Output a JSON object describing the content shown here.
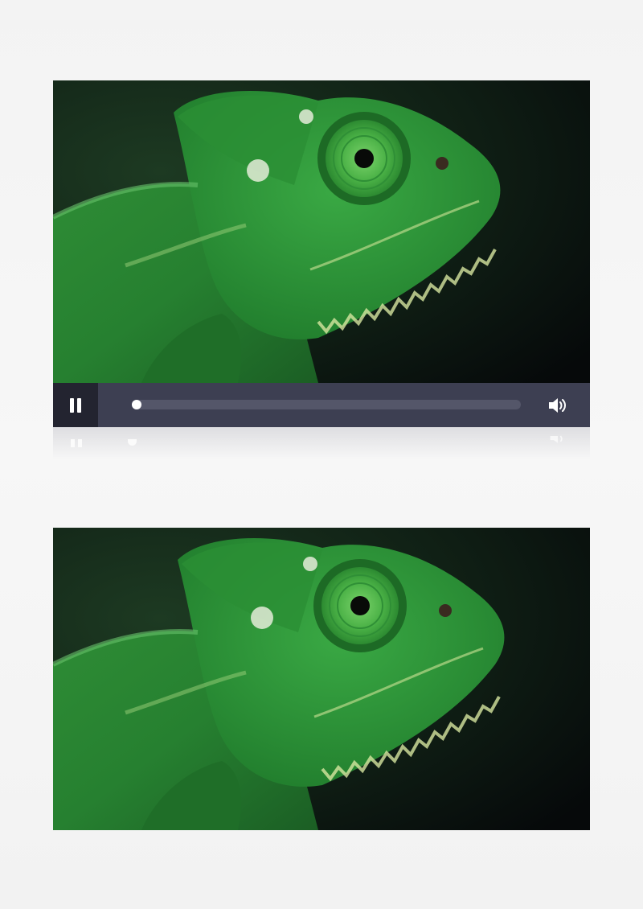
{
  "player": {
    "state": "playing",
    "progress_fraction": 0.0,
    "controls": {
      "play_pause_icon": "pause-icon",
      "volume_icon": "volume-icon"
    }
  },
  "colors": {
    "control_bar": "#3d3f52",
    "play_button_bg": "#232430",
    "track": "#545669",
    "thumb": "#ffffff",
    "chameleon_green": "#2f9a3a"
  }
}
